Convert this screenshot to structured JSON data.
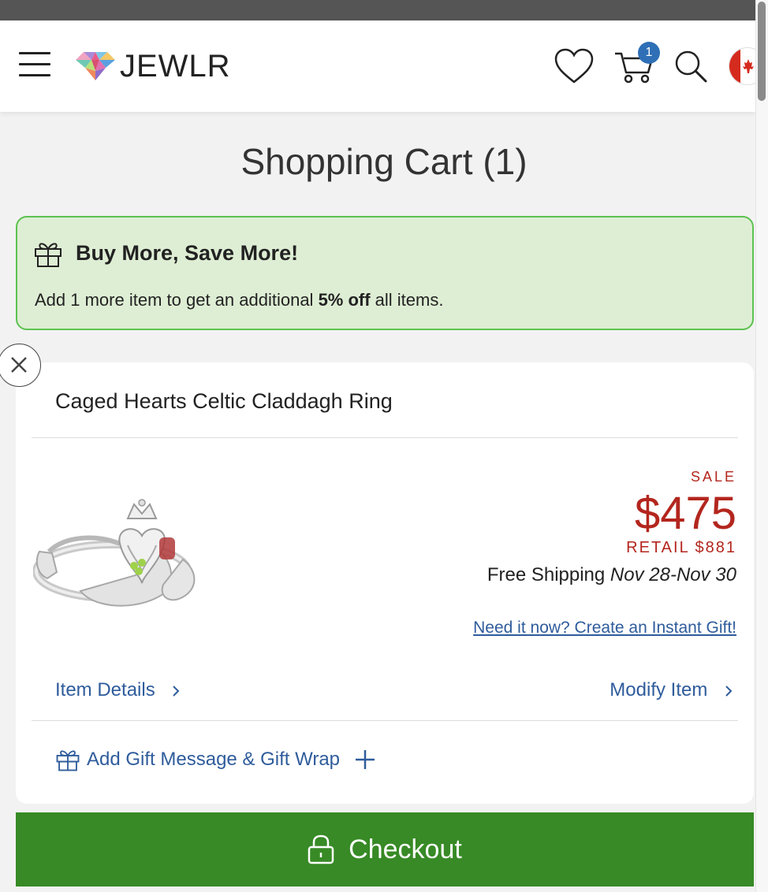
{
  "header": {
    "logo_text": "JEWLR",
    "cart_count": "1"
  },
  "page": {
    "title": "Shopping Cart (1)"
  },
  "promo": {
    "title": "Buy More, Save More!",
    "text_before": "Add 1 more item to get an additional ",
    "text_bold": "5% off",
    "text_after": " all items."
  },
  "cart_item": {
    "name": "Caged Hearts Celtic Claddagh Ring",
    "sale_label": "SALE",
    "price": "$475",
    "retail": "RETAIL $881",
    "shipping_label": "Free Shipping ",
    "shipping_dates": "Nov 28-Nov 30",
    "instant_gift_link": "Need it now? Create an Instant Gift!",
    "item_details_link": "Item Details",
    "modify_item_link": "Modify Item",
    "gift_message_link": "Add Gift Message & Gift Wrap"
  },
  "checkout": {
    "label": "Checkout"
  },
  "colors": {
    "sale_red": "#b3261e",
    "link_blue": "#2f5c9c",
    "checkout_green": "#378a25",
    "promo_bg": "#deeed4",
    "promo_border": "#5cc250",
    "badge_blue": "#2f6fb6"
  }
}
